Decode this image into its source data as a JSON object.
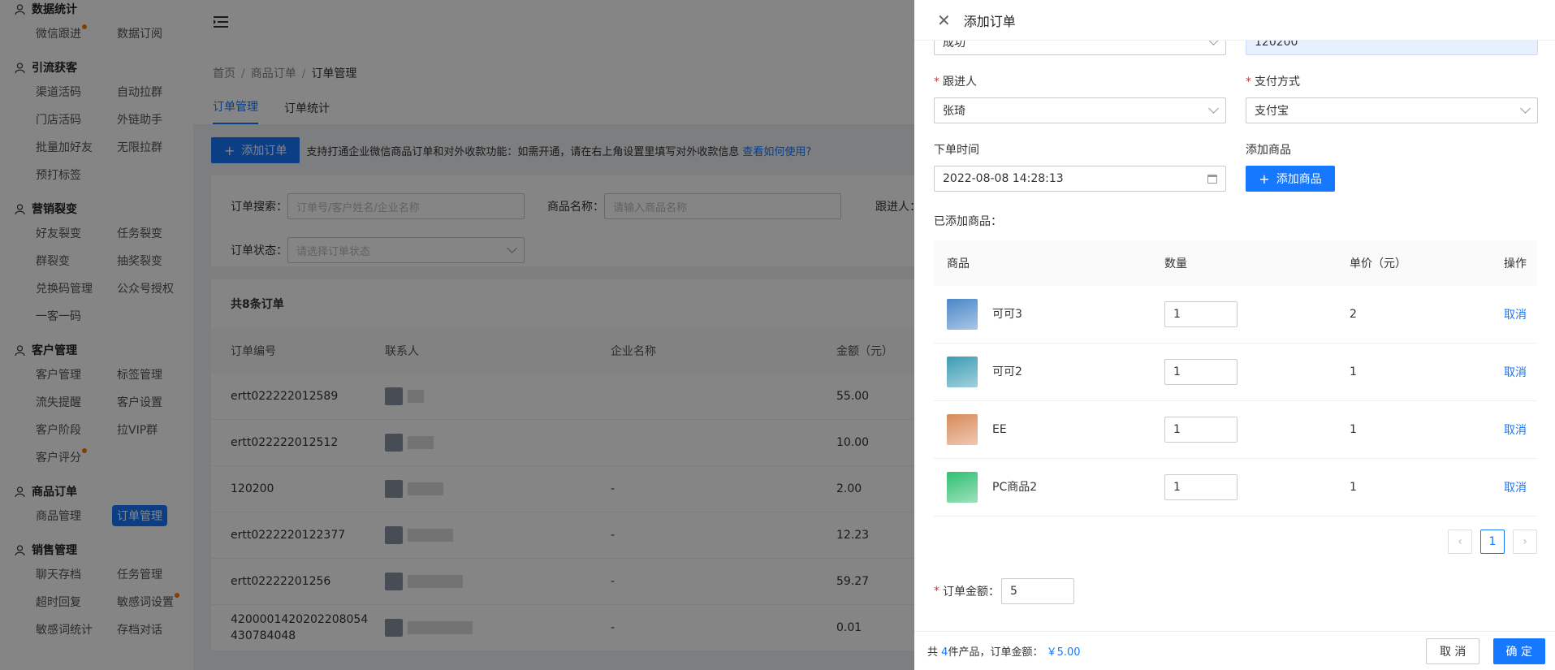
{
  "sidebar": {
    "groups": [
      {
        "title": "数据统计",
        "icon": "chart-icon",
        "items": [
          {
            "label": "微信跟进",
            "dot": true
          },
          {
            "label": "数据订阅"
          }
        ]
      },
      {
        "title": "引流获客",
        "icon": "user-icon",
        "items": [
          {
            "label": "渠道活码"
          },
          {
            "label": "自动拉群"
          },
          {
            "label": "门店活码"
          },
          {
            "label": "外链助手"
          },
          {
            "label": "批量加好友"
          },
          {
            "label": "无限拉群"
          },
          {
            "label": "预打标签"
          }
        ]
      },
      {
        "title": "营销裂变",
        "icon": "share-icon",
        "items": [
          {
            "label": "好友裂变"
          },
          {
            "label": "任务裂变"
          },
          {
            "label": "群裂变"
          },
          {
            "label": "抽奖裂变"
          },
          {
            "label": "兑换码管理"
          },
          {
            "label": "公众号授权"
          },
          {
            "label": "一客一码"
          }
        ]
      },
      {
        "title": "客户管理",
        "icon": "user-icon",
        "items": [
          {
            "label": "客户管理"
          },
          {
            "label": "标签管理"
          },
          {
            "label": "流失提醒"
          },
          {
            "label": "客户设置"
          },
          {
            "label": "客户阶段"
          },
          {
            "label": "拉VIP群"
          },
          {
            "label": "客户评分",
            "dot": true
          }
        ]
      },
      {
        "title": "商品订单",
        "icon": "user-icon",
        "items": [
          {
            "label": "商品管理"
          },
          {
            "label": "订单管理",
            "active": true
          }
        ]
      },
      {
        "title": "销售管理",
        "icon": "monitor-icon",
        "items": [
          {
            "label": "聊天存档"
          },
          {
            "label": "任务管理"
          },
          {
            "label": "超时回复"
          },
          {
            "label": "敏感词设置",
            "dot": true
          },
          {
            "label": "敏感词统计"
          },
          {
            "label": "存档对话"
          }
        ]
      }
    ]
  },
  "breadcrumb": {
    "home": "首页",
    "mid": "商品订单",
    "current": "订单管理"
  },
  "tabs": [
    "订单管理",
    "订单统计"
  ],
  "notice": {
    "add_button": "添加订单",
    "text": "支持打通企业微信商品订单和对外收款功能：如需开通，请在右上角设置里填写对外收款信息",
    "link": "查看如何使用?"
  },
  "filters": {
    "search_label": "订单搜索：",
    "search_placeholder": "订单号/客户姓名/企业名称",
    "product_label": "商品名称：",
    "product_placeholder": "请输入商品名称",
    "follower_label": "跟进人：",
    "status_label": "订单状态：",
    "status_placeholder": "请选择订单状态"
  },
  "orders": {
    "count_text": "共8条订单",
    "headers": [
      "订单编号",
      "联系人",
      "企业名称",
      "金额（元）"
    ],
    "rows": [
      {
        "id": "ertt022222012589",
        "company": "",
        "amount": "55.00"
      },
      {
        "id": "ertt022222012512",
        "company": "",
        "amount": "10.00"
      },
      {
        "id": "120200",
        "company": "-",
        "amount": "2.00"
      },
      {
        "id": "ertt0222220122377",
        "company": "-",
        "amount": "12.23"
      },
      {
        "id": "ertt02222201256",
        "company": "-",
        "amount": "59.27"
      },
      {
        "id": "4200001420202208054430784048",
        "company": "-",
        "amount": "0.01"
      }
    ]
  },
  "drawer": {
    "title": "添加订单",
    "top_left_value": "成功",
    "top_right_value": "120200",
    "follower_label": "跟进人",
    "follower_value": "张琦",
    "payment_label": "支付方式",
    "payment_value": "支付宝",
    "time_label": "下单时间",
    "time_value": "2022-08-08 14:28:13",
    "add_product_label": "添加商品",
    "add_product_button": "添加商品",
    "added_label": "已添加商品：",
    "table_headers": [
      "商品",
      "数量",
      "单价（元）",
      "操作"
    ],
    "products": [
      {
        "name": "可可3",
        "qty": "1",
        "price": "2",
        "action": "取消",
        "color": "#4a86c8"
      },
      {
        "name": "可可2",
        "qty": "1",
        "price": "1",
        "action": "取消",
        "color": "#3b9bb5"
      },
      {
        "name": "EE",
        "qty": "1",
        "price": "1",
        "action": "取消",
        "color": "#d98a5a"
      },
      {
        "name": "PC商品2",
        "qty": "1",
        "price": "1",
        "action": "取消",
        "color": "#2fbf71"
      }
    ],
    "page": "1",
    "amount_label": "订单金额：",
    "amount_value": "5",
    "footer": {
      "prefix": "共",
      "count": "4",
      "middle": "件产品，订单金额：",
      "total": "￥5.00",
      "cancel": "取 消",
      "confirm": "确 定"
    }
  },
  "colors": {
    "primary": "#1677ff",
    "required": "#f5222d",
    "dot": "#f57c00"
  }
}
